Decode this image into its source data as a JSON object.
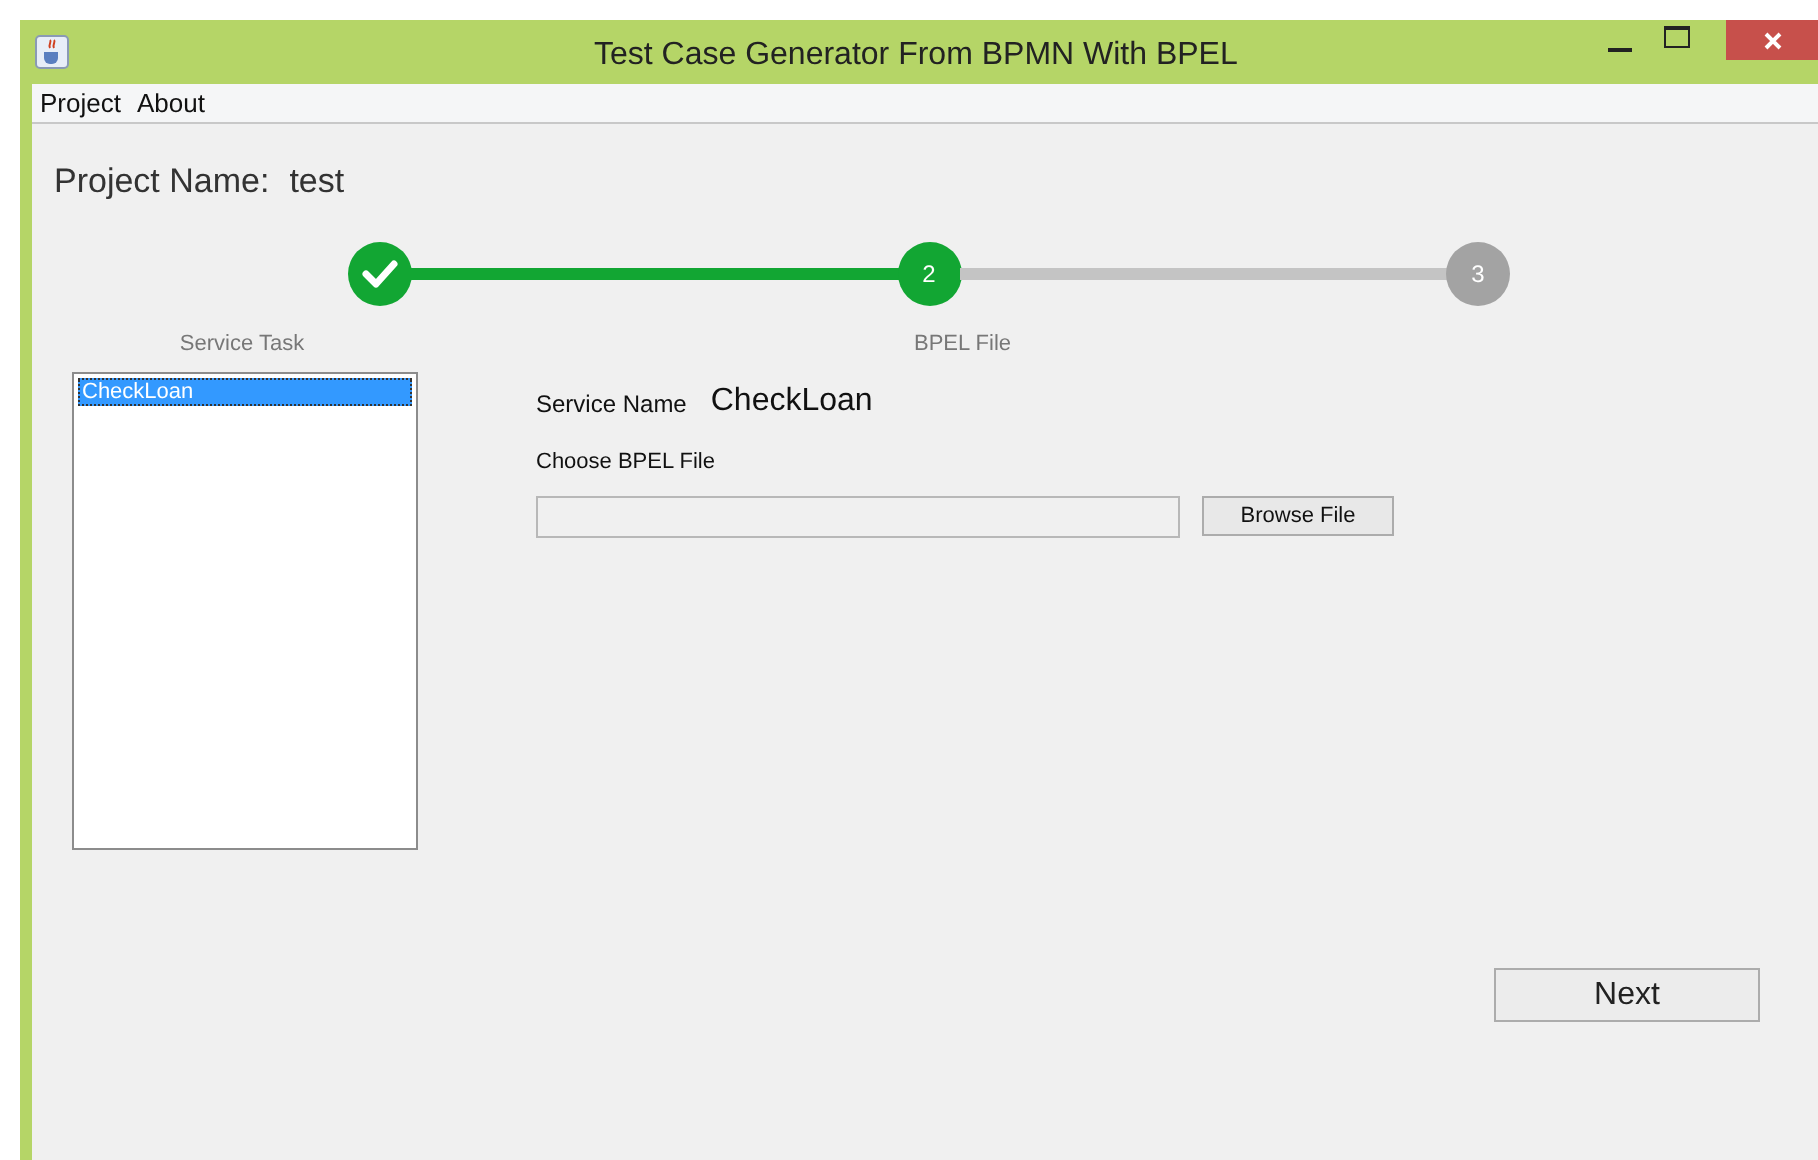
{
  "window": {
    "title": "Test Case Generator From BPMN With BPEL"
  },
  "menu": [
    "Project",
    "About"
  ],
  "project": {
    "label": "Project Name:",
    "value": "test"
  },
  "steps": [
    {
      "completed": true,
      "selected": false
    },
    {
      "completed": false,
      "selected": true,
      "label": "2"
    },
    {
      "completed": false,
      "selected": false,
      "label": "3"
    }
  ],
  "service_task": {
    "heading": "Service Task",
    "items": [
      {
        "label": "CheckLoan",
        "selected": true
      }
    ]
  },
  "bpel_file": {
    "heading": "BPEL File",
    "service_name_label": "Service Name",
    "service_name": "CheckLoan",
    "choose_label": "Choose BPEL File",
    "browse_button": "Browse File"
  },
  "next_button": "Next"
}
